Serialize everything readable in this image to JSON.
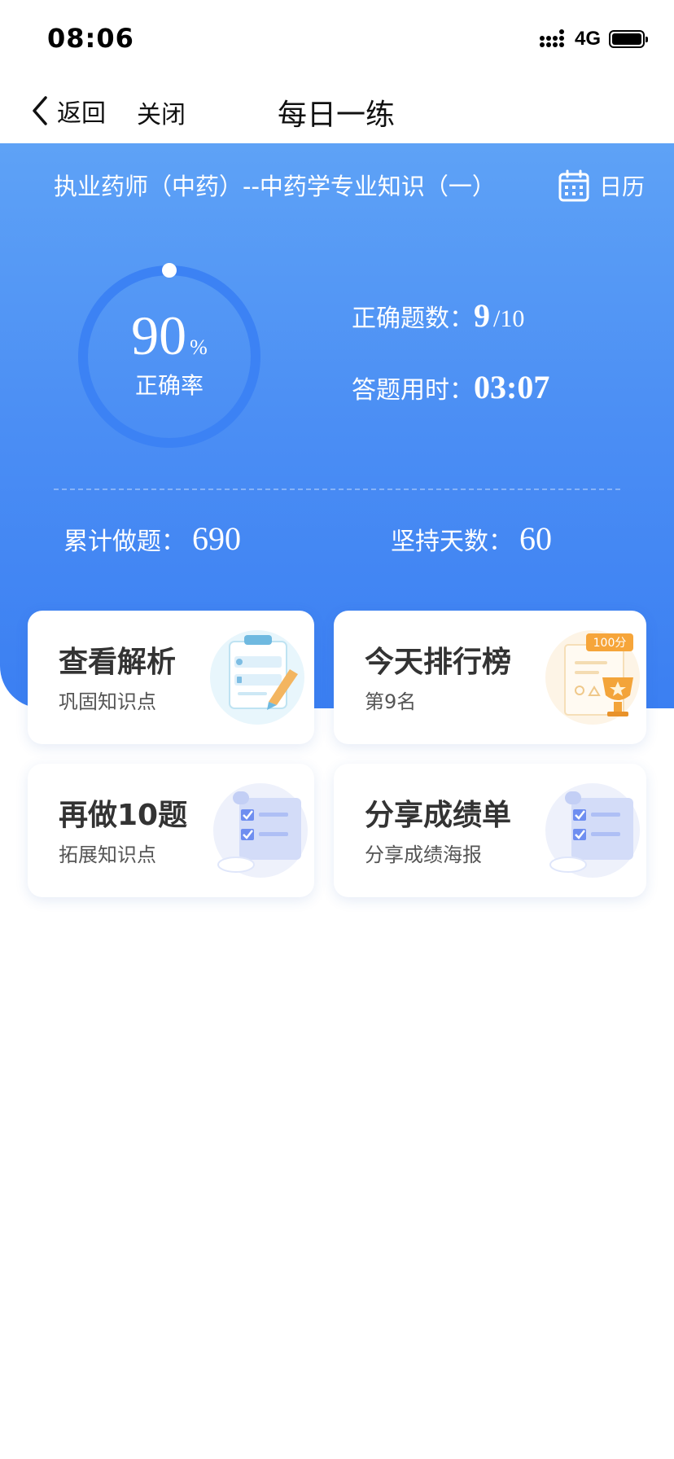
{
  "status_bar": {
    "time": "08:06",
    "network": "4G"
  },
  "nav": {
    "back_label": "返回",
    "close_label": "关闭",
    "title": "每日一练"
  },
  "hero": {
    "course_name": "执业药师（中药）--中药学专业知识（一）",
    "calendar_label": "日历",
    "accuracy": {
      "value": "90",
      "unit": "%",
      "label": "正确率",
      "fraction": 0.9
    },
    "correct": {
      "label": "正确题数：",
      "value": "9",
      "total": "/10"
    },
    "duration": {
      "label": "答题用时：",
      "value": "03:07"
    },
    "total_done": {
      "label": "累计做题：",
      "value": "690"
    },
    "streak_days": {
      "label": "坚持天数：",
      "value": "60"
    }
  },
  "cards": [
    {
      "title": "查看解析",
      "subtitle": "巩固知识点"
    },
    {
      "title": "今天排行榜",
      "subtitle": "第9名",
      "badge": "100分"
    },
    {
      "title": "再做10题",
      "subtitle": "拓展知识点"
    },
    {
      "title": "分享成绩单",
      "subtitle": "分享成绩海报"
    }
  ],
  "colors": {
    "hero_top": "#5ea2f6",
    "hero_bottom": "#3b7ff2",
    "ring": "#3c82f4",
    "card_title": "#333333"
  }
}
